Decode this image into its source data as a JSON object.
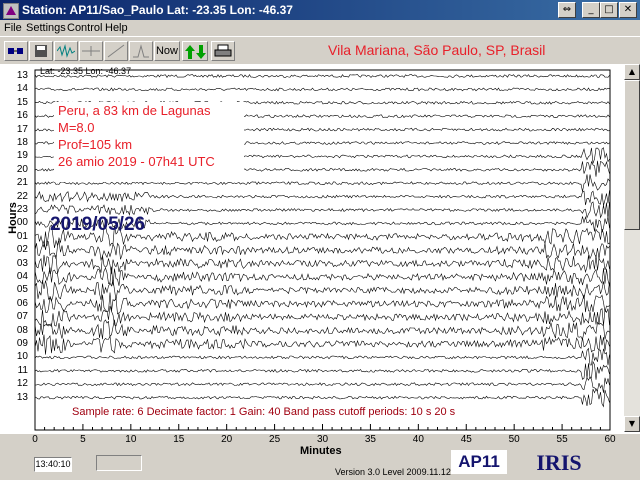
{
  "window": {
    "title": "Station: AP11/Sao_Paulo Lat: -23.35 Lon: -46.37",
    "controls": [
      "⇔",
      "_",
      "□",
      "✕"
    ]
  },
  "menu": [
    "File",
    "Settings",
    "Control",
    "Help"
  ],
  "toolbar": {
    "now_label": "Now",
    "station_location": "Vila Mariana, São Paulo, SP, Brasil"
  },
  "plot": {
    "latlon": "Lat: -23.35 Lon: -46.37",
    "hours_label": "Hours",
    "hour_labels": [
      "13",
      "14",
      "15",
      "16",
      "17",
      "18",
      "19",
      "20",
      "21",
      "22",
      "23",
      "00",
      "01",
      "02",
      "03",
      "04",
      "05",
      "06",
      "07",
      "08",
      "09",
      "10",
      "11",
      "12",
      "13"
    ],
    "minutes_label": "Minutes",
    "minute_ticks": [
      "0",
      "5",
      "10",
      "15",
      "20",
      "25",
      "30",
      "35",
      "40",
      "45",
      "50",
      "55",
      "60"
    ],
    "event": {
      "line1": "Peru, a 83 km de Lagunas",
      "line2": "M=8.0",
      "line3": "Prof=105 km",
      "line4": "26 amio 2019 - 07h41 UTC"
    },
    "date": "2019/05/26",
    "params": "Sample rate: 6  Decimate factor: 1  Gain: 40  Band pass cutoff periods: 10 s 20 s"
  },
  "status": {
    "clock": "13:40:10",
    "version": "Version 3.0 Level 2009.11.12",
    "station_code": "AP11",
    "logo_text": "IRIS"
  },
  "colors": {
    "accent_red": "#e8202a",
    "navy": "#16166e",
    "trace": "#000000"
  }
}
